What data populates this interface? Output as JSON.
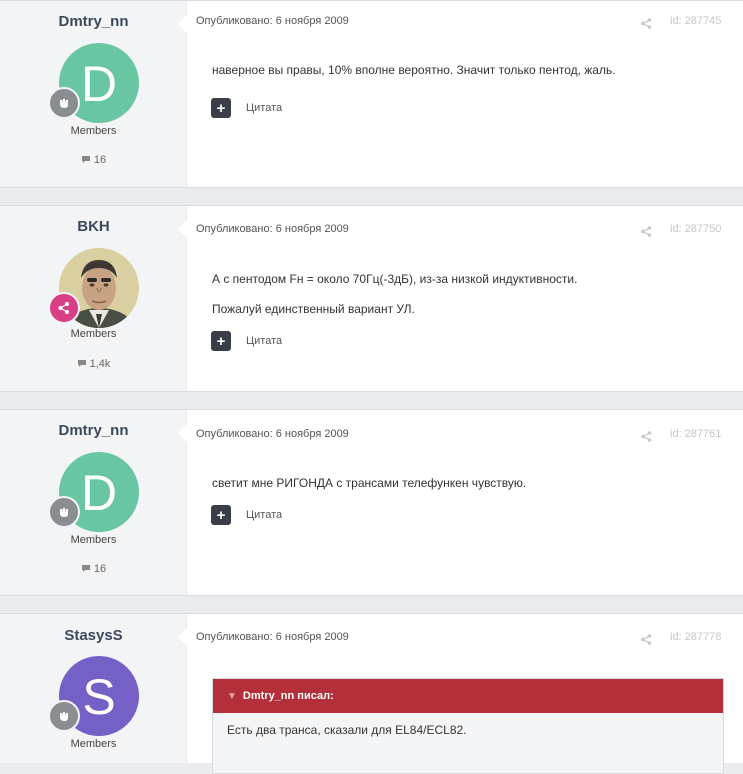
{
  "ui": {
    "meta_prefix": "Опубликовано: ",
    "quote_button_label": "Цитата",
    "plus_glyph": "+",
    "colors": {
      "accent_quote_header": "#b3303a",
      "avatar_teal": "#68c6a2",
      "avatar_purple": "#7460c6",
      "badge_grey": "#8a8e93",
      "badge_pink": "#d93f86"
    }
  },
  "posts": [
    {
      "author": "Dmtry_nn",
      "avatar_letter": "D",
      "avatar_color": "#68c6a2",
      "group": "Members",
      "post_count": "16",
      "date": "6 ноября 2009",
      "post_id": "id: 287745",
      "paragraphs": [
        "наверное вы правы, 10% вполне вероятно. Значит только пентод, жаль."
      ]
    },
    {
      "author": "BKH",
      "avatar_type": "photo",
      "group": "Members",
      "post_count": "1,4k",
      "date": "6 ноября 2009",
      "post_id": "id: 287750",
      "paragraphs": [
        "А с пентодом Fн = около 70Гц(-3дБ), из-за низкой индуктивности.",
        "Пожалуй единственный вариант УЛ."
      ]
    },
    {
      "author": "Dmtry_nn",
      "avatar_letter": "D",
      "avatar_color": "#68c6a2",
      "group": "Members",
      "post_count": "16",
      "date": "6 ноября 2009",
      "post_id": "id: 287761",
      "paragraphs": [
        "светит мне РИГОНДА с трансами телефункен чувствую."
      ]
    },
    {
      "author": "StasysS",
      "avatar_letter": "S",
      "avatar_color": "#7460c6",
      "group": "Members",
      "date": "6 ноября 2009",
      "post_id": "id: 287778",
      "quote_author": "Dmtry_nn писал:",
      "quote_text": "Есть два транса, сказали для EL84/ECL82."
    }
  ]
}
